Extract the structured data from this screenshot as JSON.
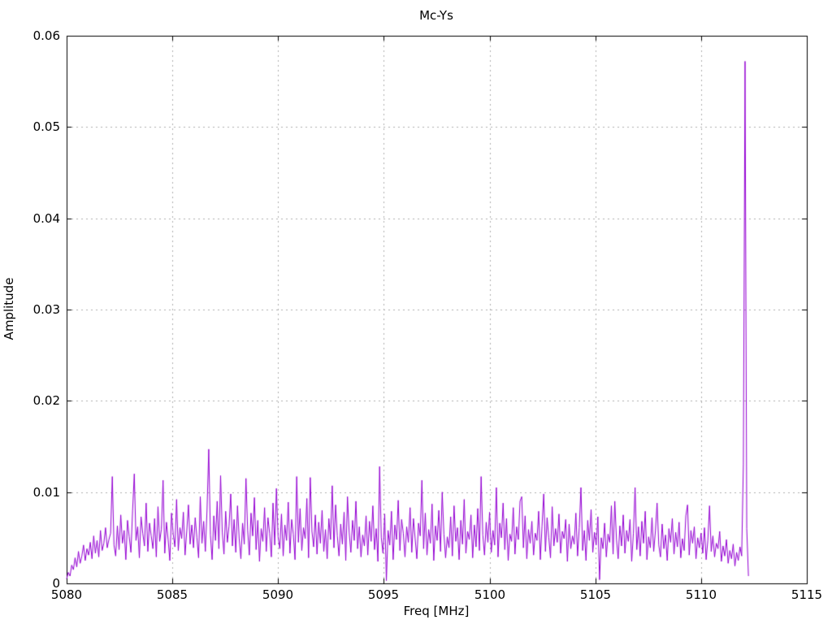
{
  "chart_data": {
    "type": "line",
    "title": "Mc-Ys",
    "xlabel": "Freq [MHz]",
    "ylabel": "Amplitude",
    "xlim": [
      5080,
      5115
    ],
    "ylim": [
      0,
      0.06
    ],
    "xticks": [
      5080,
      5085,
      5090,
      5095,
      5100,
      5105,
      5110,
      5115
    ],
    "xtick_labels": [
      "5080",
      "5085",
      "5090",
      "5095",
      "5100",
      "5105",
      "5110",
      "5115"
    ],
    "yticks": [
      0,
      0.01,
      0.02,
      0.03,
      0.04,
      0.05,
      0.06
    ],
    "ytick_labels": [
      "0",
      "0.01",
      "0.02",
      "0.03",
      "0.04",
      "0.05",
      "0.06"
    ],
    "grid": true,
    "legend": "none",
    "line_color": "#9400d3",
    "grid_color": "#b0b0b0",
    "border_color": "#000000",
    "background_color": "#ffffff",
    "main_peak": {
      "freq_mhz": 5112.08,
      "amplitude": 0.0572
    },
    "noise_floor_mean": 0.0045,
    "noise_max": 0.0147,
    "series": [
      {
        "name": "Mc-Ys",
        "x_start": 5080.0,
        "x_step": 0.08,
        "values_scale": 0.0001,
        "values": [
          5,
          12,
          8,
          20,
          15,
          28,
          18,
          35,
          22,
          30,
          42,
          25,
          38,
          31,
          45,
          27,
          52,
          33,
          47,
          29,
          58,
          36,
          44,
          61,
          39,
          48,
          55,
          117,
          42,
          30,
          63,
          37,
          75,
          44,
          58,
          26,
          69,
          51,
          34,
          80,
          120,
          47,
          62,
          28,
          73,
          55,
          41,
          88,
          35,
          66,
          52,
          38,
          71,
          29,
          84,
          46,
          59,
          113,
          33,
          67,
          48,
          25,
          77,
          54,
          40,
          92,
          36,
          61,
          49,
          78,
          31,
          57,
          86,
          43,
          64,
          39,
          72,
          50,
          28,
          95,
          44,
          68,
          35,
          81,
          147,
          53,
          26,
          74,
          47,
          90,
          38,
          118,
          56,
          32,
          79,
          45,
          63,
          98,
          41,
          70,
          34,
          85,
          49,
          27,
          66,
          43,
          115,
          58,
          31,
          77,
          52,
          94,
          37,
          69,
          24,
          60,
          46,
          83,
          35,
          72,
          55,
          29,
          88,
          42,
          104,
          51,
          38,
          76,
          30,
          64,
          47,
          89,
          33,
          70,
          54,
          26,
          117,
          45,
          82,
          36,
          61,
          49,
          93,
          28,
          116,
          57,
          40,
          75,
          32,
          67,
          44,
          80,
          35,
          59,
          27,
          71,
          48,
          107,
          39,
          86,
          52,
          30,
          65,
          43,
          78,
          25,
          95,
          56,
          34,
          69,
          47,
          90,
          38,
          62,
          29,
          53,
          41,
          74,
          31,
          68,
          46,
          85,
          37,
          60,
          24,
          128,
          50,
          33,
          76,
          3,
          58,
          42,
          79,
          26,
          64,
          48,
          91,
          36,
          70,
          55,
          29,
          62,
          45,
          83,
          34,
          71,
          49,
          27,
          66,
          52,
          113,
          38,
          77,
          31,
          59,
          44,
          87,
          25,
          63,
          47,
          80,
          35,
          100,
          54,
          28,
          51,
          39,
          73,
          30,
          85,
          46,
          61,
          26,
          69,
          43,
          92,
          33,
          57,
          48,
          75,
          28,
          64,
          40,
          82,
          36,
          117,
          53,
          31,
          67,
          45,
          78,
          34,
          58,
          42,
          105,
          29,
          66,
          50,
          88,
          37,
          71,
          25,
          54,
          46,
          83,
          32,
          62,
          48,
          90,
          95,
          39,
          74,
          27,
          59,
          44,
          68,
          31,
          55,
          47,
          79,
          26,
          63,
          98,
          35,
          72,
          50,
          28,
          84,
          41,
          60,
          45,
          76,
          33,
          57,
          49,
          70,
          24,
          65,
          38,
          52,
          43,
          77,
          30,
          61,
          105,
          36,
          58,
          25,
          69,
          47,
          81,
          34,
          56,
          42,
          73,
          4,
          50,
          38,
          66,
          29,
          54,
          45,
          85,
          32,
          90,
          48,
          27,
          63,
          41,
          75,
          33,
          58,
          46,
          70,
          24,
          55,
          105,
          37,
          62,
          30,
          68,
          44,
          79,
          26,
          51,
          39,
          72,
          35,
          57,
          88,
          42,
          29,
          65,
          38,
          53,
          25,
          60,
          45,
          71,
          32,
          56,
          40,
          67,
          28,
          49,
          36,
          74,
          86,
          31,
          58,
          44,
          62,
          27,
          50,
          39,
          55,
          33,
          61,
          26,
          47,
          85,
          35,
          52,
          29,
          44,
          38,
          57,
          24,
          41,
          30,
          48,
          22,
          36,
          27,
          43,
          19,
          34,
          25,
          40,
          30,
          130,
          572,
          60,
          8
        ]
      }
    ]
  }
}
